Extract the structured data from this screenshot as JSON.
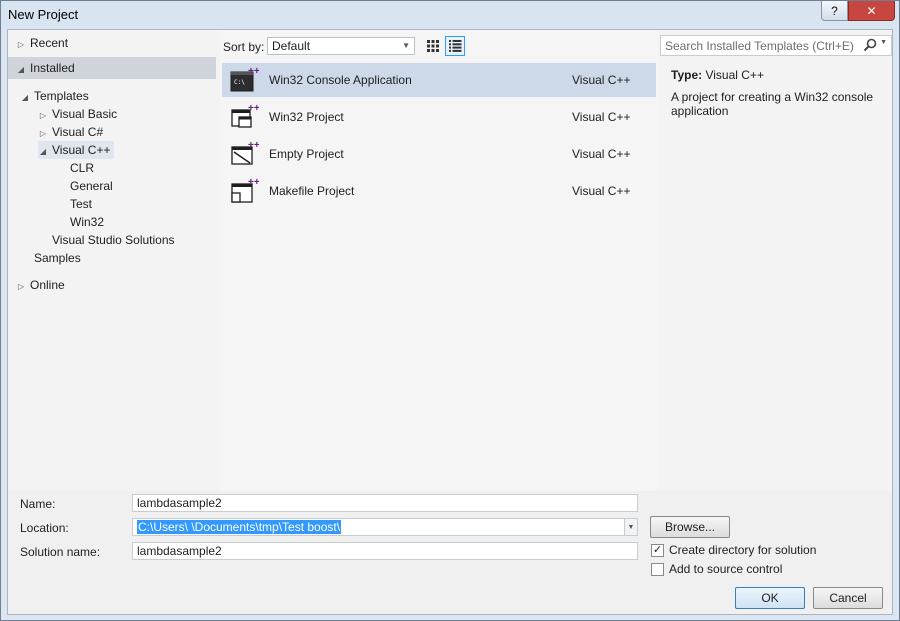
{
  "window": {
    "title": "New Project",
    "help_label": "?",
    "close_label": "✕"
  },
  "tree": {
    "recent": "Recent",
    "installed": "Installed",
    "templates": "Templates",
    "visual_basic": "Visual Basic",
    "visual_csharp": "Visual C#",
    "visual_cpp": "Visual C++",
    "clr": "CLR",
    "general": "General",
    "test": "Test",
    "win32": "Win32",
    "vs_solutions": "Visual Studio Solutions",
    "samples": "Samples",
    "online": "Online"
  },
  "sortbar": {
    "label": "Sort by:",
    "value": "Default"
  },
  "templates": [
    {
      "name": "Win32 Console Application",
      "lang": "Visual C++",
      "icon": "console-app-icon",
      "selected": true
    },
    {
      "name": "Win32 Project",
      "lang": "Visual C++",
      "icon": "win32-project-icon",
      "selected": false
    },
    {
      "name": "Empty Project",
      "lang": "Visual C++",
      "icon": "empty-project-icon",
      "selected": false
    },
    {
      "name": "Makefile Project",
      "lang": "Visual C++",
      "icon": "makefile-project-icon",
      "selected": false
    }
  ],
  "details": {
    "search_placeholder": "Search Installed Templates (Ctrl+E)",
    "type_label": "Type:",
    "type_value": "Visual C++",
    "description": "A project for creating a Win32 console application"
  },
  "form": {
    "name_label": "Name:",
    "name_value": "lambdasample2",
    "location_label": "Location:",
    "location_value": "C:\\Users\\ \\Documents\\tmp\\Test boost\\",
    "solution_label": "Solution name:",
    "solution_value": "lambdasample2",
    "browse_label": "Browse...",
    "create_dir_label": "Create directory for solution",
    "create_dir_checked": true,
    "source_control_label": "Add to source control",
    "source_control_checked": false,
    "ok_label": "OK",
    "cancel_label": "Cancel"
  },
  "colors": {
    "selection": "#cdd9e8",
    "accent": "#3399ff",
    "vs_purple": "#68217a"
  }
}
